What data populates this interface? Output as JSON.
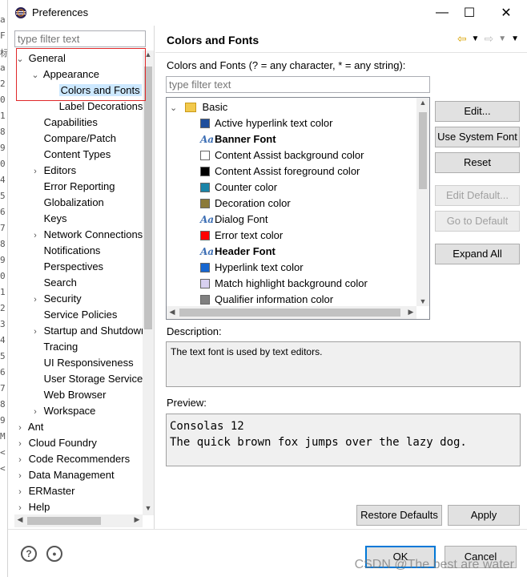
{
  "window": {
    "title": "Preferences",
    "controls": {
      "minimize": "—",
      "maximize": "☐",
      "close": "✕"
    }
  },
  "left_filter_placeholder": "type filter text",
  "tree": [
    {
      "label": "General",
      "twisty": "⌄",
      "level": 0
    },
    {
      "label": "Appearance",
      "twisty": "⌄",
      "level": 1
    },
    {
      "label": "Colors and Fonts",
      "twisty": "",
      "level": 2,
      "selected": true
    },
    {
      "label": "Label Decorations",
      "twisty": "",
      "level": 2
    },
    {
      "label": "Capabilities",
      "twisty": "",
      "level": 1
    },
    {
      "label": "Compare/Patch",
      "twisty": "",
      "level": 1
    },
    {
      "label": "Content Types",
      "twisty": "",
      "level": 1
    },
    {
      "label": "Editors",
      "twisty": "›",
      "level": 1
    },
    {
      "label": "Error Reporting",
      "twisty": "",
      "level": 1
    },
    {
      "label": "Globalization",
      "twisty": "",
      "level": 1
    },
    {
      "label": "Keys",
      "twisty": "",
      "level": 1
    },
    {
      "label": "Network Connections",
      "twisty": "›",
      "level": 1
    },
    {
      "label": "Notifications",
      "twisty": "",
      "level": 1
    },
    {
      "label": "Perspectives",
      "twisty": "",
      "level": 1
    },
    {
      "label": "Search",
      "twisty": "",
      "level": 1
    },
    {
      "label": "Security",
      "twisty": "›",
      "level": 1
    },
    {
      "label": "Service Policies",
      "twisty": "",
      "level": 1
    },
    {
      "label": "Startup and Shutdown",
      "twisty": "›",
      "level": 1
    },
    {
      "label": "Tracing",
      "twisty": "",
      "level": 1
    },
    {
      "label": "UI Responsiveness",
      "twisty": "",
      "level": 1
    },
    {
      "label": "User Storage Service",
      "twisty": "",
      "level": 1
    },
    {
      "label": "Web Browser",
      "twisty": "",
      "level": 1
    },
    {
      "label": "Workspace",
      "twisty": "›",
      "level": 1
    },
    {
      "label": "Ant",
      "twisty": "›",
      "level": 0
    },
    {
      "label": "Cloud Foundry",
      "twisty": "›",
      "level": 0
    },
    {
      "label": "Code Recommenders",
      "twisty": "›",
      "level": 0
    },
    {
      "label": "Data Management",
      "twisty": "›",
      "level": 0
    },
    {
      "label": "ERMaster",
      "twisty": "›",
      "level": 0
    },
    {
      "label": "Help",
      "twisty": "›",
      "level": 0
    }
  ],
  "page": {
    "title": "Colors and Fonts",
    "hint": "Colors and Fonts (? = any character, * = any string):",
    "filter_placeholder": "type filter text",
    "category": "Basic",
    "items": [
      {
        "label": "Active hyperlink text color",
        "kind": "color",
        "color": "#1f4e9c"
      },
      {
        "label": "Banner Font",
        "kind": "font",
        "bold": true
      },
      {
        "label": "Content Assist background color",
        "kind": "color",
        "color": "#ffffff"
      },
      {
        "label": "Content Assist foreground color",
        "kind": "color",
        "color": "#000000"
      },
      {
        "label": "Counter color",
        "kind": "color",
        "color": "#1a84a8"
      },
      {
        "label": "Decoration color",
        "kind": "color",
        "color": "#8b7a3a"
      },
      {
        "label": "Dialog Font",
        "kind": "font",
        "bold": false
      },
      {
        "label": "Error text color",
        "kind": "color",
        "color": "#ff0000"
      },
      {
        "label": "Header Font",
        "kind": "font",
        "bold": true
      },
      {
        "label": "Hyperlink text color",
        "kind": "color",
        "color": "#1666d0"
      },
      {
        "label": "Match highlight background color",
        "kind": "color",
        "color": "#d8d0f0"
      },
      {
        "label": "Qualifier information color",
        "kind": "color",
        "color": "#808080"
      }
    ],
    "buttons": {
      "edit": "Edit...",
      "use_system_font": "Use System Font",
      "reset": "Reset",
      "edit_default": "Edit Default...",
      "go_to_default": "Go to Default",
      "expand_all": "Expand All"
    },
    "description_label": "Description:",
    "description": "The text font is used by text editors.",
    "preview_label": "Preview:",
    "preview_lines": [
      "Consolas 12",
      "The quick brown fox jumps over the lazy dog."
    ],
    "restore_defaults": "Restore Defaults",
    "apply": "Apply"
  },
  "footer": {
    "ok": "OK",
    "cancel": "Cancel",
    "watermark": "CSDN @The best are water"
  },
  "bg_line_numbers": [
    "a",
    "F",
    "标",
    "a",
    "2",
    "0",
    "1",
    "8",
    "9",
    "0",
    "4",
    "5",
    "6",
    "7",
    "8",
    "9",
    "0",
    "1",
    "2",
    "3",
    "4",
    "5",
    "6",
    "7",
    "8",
    "9",
    "M",
    "<",
    "<"
  ]
}
